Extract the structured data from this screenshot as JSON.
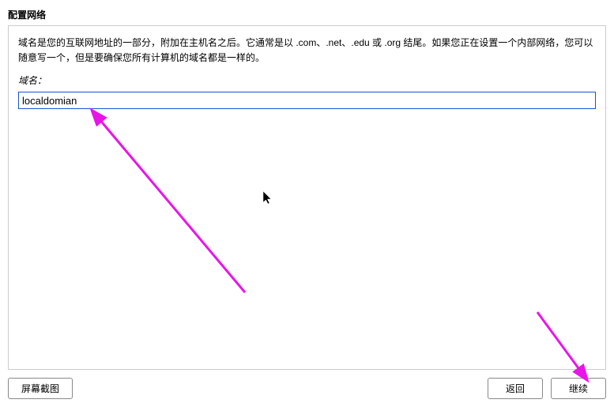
{
  "header": {
    "title": "配置网络"
  },
  "main": {
    "description": "域名是您的互联网地址的一部分，附加在主机名之后。它通常是以 .com、.net、.edu 或 .org 结尾。如果您正在设置一个内部网络，您可以随意写一个，但是要确保您所有计算机的域名都是一样的。",
    "field_label": "域名：",
    "domain_value": "localdomian"
  },
  "footer": {
    "screenshot_label": "屏幕截图",
    "back_label": "返回",
    "continue_label": "继续"
  }
}
